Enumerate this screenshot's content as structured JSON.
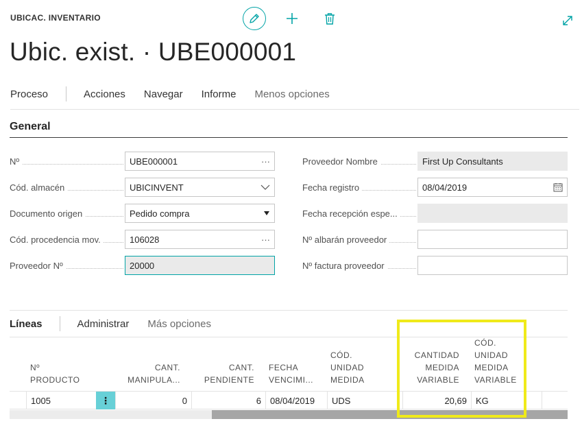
{
  "header": {
    "caption": "UBICAC. INVENTARIO",
    "title": "Ubic. exist. · UBE000001"
  },
  "colors": {
    "accent": "#00a3a6",
    "highlight": "#f0ea1a",
    "row_menu": "#67d0d7"
  },
  "actions": {
    "proceso": "Proceso",
    "acciones": "Acciones",
    "navegar": "Navegar",
    "informe": "Informe",
    "menos": "Menos opciones"
  },
  "general": {
    "title": "General",
    "fields": {
      "no": {
        "label": "Nº",
        "value": "UBE000001"
      },
      "almacen": {
        "label": "Cód. almacén",
        "value": "UBICINVENT"
      },
      "doc_origen": {
        "label": "Documento origen",
        "value": "Pedido compra"
      },
      "procedencia": {
        "label": "Cód. procedencia mov.",
        "value": "106028"
      },
      "proveedor_no": {
        "label": "Proveedor Nº",
        "value": "20000"
      },
      "proveedor_nombre": {
        "label": "Proveedor Nombre",
        "value": "First Up Consultants"
      },
      "fecha_registro": {
        "label": "Fecha registro",
        "value": "08/04/2019"
      },
      "fecha_recepcion": {
        "label": "Fecha recepción espe...",
        "value": ""
      },
      "albaran": {
        "label": "Nº albarán proveedor",
        "value": ""
      },
      "factura": {
        "label": "Nº factura proveedor",
        "value": ""
      }
    }
  },
  "lines": {
    "title": "Líneas",
    "administrar": "Administrar",
    "mas": "Más opciones",
    "columns": {
      "producto_1": "Nº",
      "producto_2": "PRODUCTO",
      "manip_1": "CANT.",
      "manip_2": "MANIPULA...",
      "pend_1": "CANT.",
      "pend_2": "PENDIENTE",
      "fecha_1": "FECHA",
      "fecha_2": "VENCIMI...",
      "unidad_1": "CÓD.",
      "unidad_2": "UNIDAD",
      "unidad_3": "MEDIDA",
      "cantvar_1": "CANTIDAD",
      "cantvar_2": "MEDIDA",
      "cantvar_3": "VARIABLE",
      "codvar_1": "CÓD.",
      "codvar_2": "UNIDAD",
      "codvar_3": "MEDIDA",
      "codvar_4": "VARIABLE"
    },
    "rows": [
      {
        "producto": "1005",
        "manipular": "0",
        "pendiente": "6",
        "fecha": "08/04/2019",
        "unidad": "UDS",
        "cant_variable": "20,69",
        "cod_variable": "KG"
      }
    ]
  }
}
